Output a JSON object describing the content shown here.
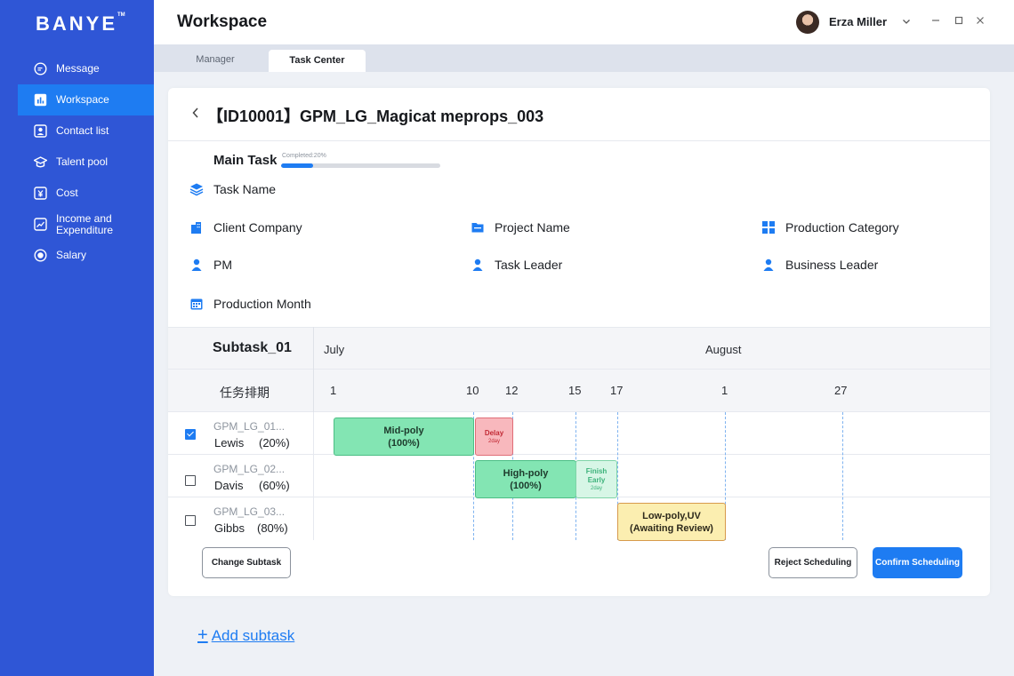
{
  "app": {
    "logo": "BANYE",
    "logo_mark": "TM"
  },
  "sidebar": {
    "items": [
      {
        "label": "Message",
        "icon": "message-icon"
      },
      {
        "label": "Workspace",
        "icon": "chart-icon",
        "active": true
      },
      {
        "label": "Contact list",
        "icon": "contact-icon"
      },
      {
        "label": "Talent pool",
        "icon": "graduation-icon"
      },
      {
        "label": "Cost",
        "icon": "yen-icon"
      },
      {
        "label": "Income and Expenditure",
        "icon": "trend-icon"
      },
      {
        "label": "Salary",
        "icon": "coin-icon"
      }
    ]
  },
  "header": {
    "title": "Workspace",
    "user": "Erza Miller"
  },
  "tabs": [
    {
      "label": "Manager"
    },
    {
      "label": "Task Center",
      "active": true
    }
  ],
  "task": {
    "title": "【ID10001】GPM_LG_Magicat meprops_003",
    "main_task_label": "Main Task",
    "progress_label": "Completed:20%",
    "progress": 0.2,
    "fields": {
      "task_name": "Task Name",
      "client_company": "Client Company",
      "project_name": "Project Name",
      "production_category": "Production Category",
      "pm": "PM",
      "task_leader": "Task Leader",
      "business_leader": "Business Leader",
      "production_month": "Production Month"
    }
  },
  "schedule": {
    "subtask_title": "Subtask_01",
    "months": [
      "July",
      "August"
    ],
    "schedule_label": "任务排期",
    "days": [
      "1",
      "10",
      "12",
      "15",
      "17",
      "1",
      "27"
    ],
    "rows": [
      {
        "code": "GPM_LG_01...",
        "name": "Lewis",
        "pct": "(20%)",
        "checked": true
      },
      {
        "code": "GPM_LG_02...",
        "name": "Davis",
        "pct": "(60%)",
        "checked": false
      },
      {
        "code": "GPM_LG_03...",
        "name": "Gibbs",
        "pct": "(80%)",
        "checked": false
      }
    ],
    "bars": {
      "midpoly": {
        "line1": "Mid-poly",
        "line2": "(100%)"
      },
      "delay": {
        "line1": "Delay",
        "line2": "2day"
      },
      "highpoly": {
        "line1": "High-poly",
        "line2": "(100%)"
      },
      "finish_early": {
        "line1": "Finish Early",
        "line2": "2day"
      },
      "lowpoly": {
        "line1": "Low-poly,UV",
        "line2": "(Awaiting Review)"
      }
    }
  },
  "buttons": {
    "change_subtask": "Change Subtask",
    "reject_scheduling": "Reject Scheduling",
    "confirm_scheduling": "Confirm Scheduling"
  },
  "add_subtask": "Add subtask",
  "colors": {
    "sidebar": "#2f56d6",
    "accent": "#1e7cf2",
    "active_nav": "#1e7cf2"
  }
}
